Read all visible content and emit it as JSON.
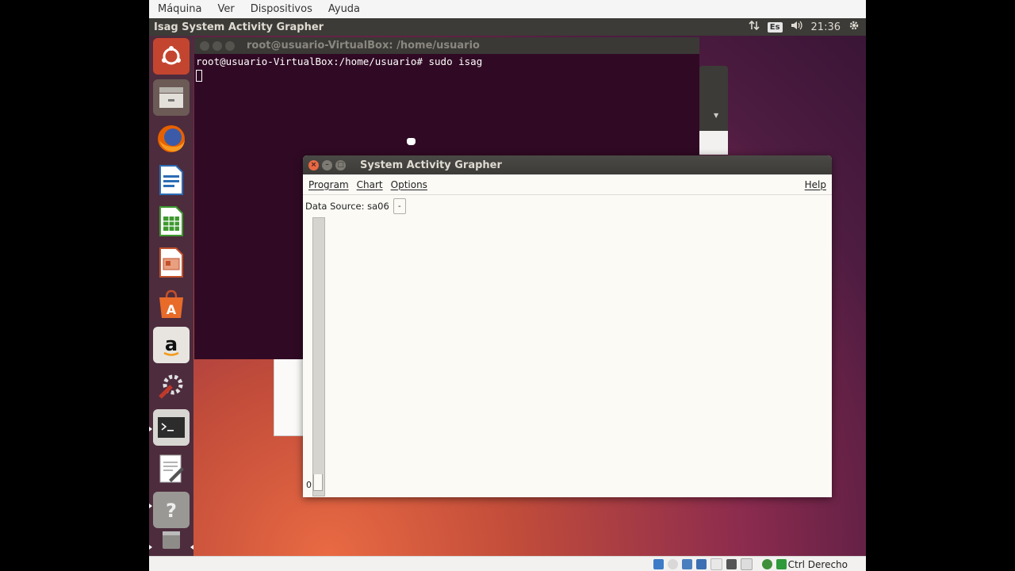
{
  "vbox_menu": [
    "Máquina",
    "Ver",
    "Dispositivos",
    "Ayuda"
  ],
  "panel": {
    "title": "Isag System Activity Grapher",
    "keyboard_layout": "Es",
    "time": "21:36"
  },
  "terminal": {
    "title": "root@usuario-VirtualBox: /home/usuario",
    "prompt_line": "root@usuario-VirtualBox:/home/usuario# sudo isag"
  },
  "isag": {
    "title": "System Activity Grapher",
    "menu": {
      "program": "Program",
      "chart": "Chart",
      "options": "Options",
      "help": "Help"
    },
    "data_source_label": "Data Source: sa06",
    "data_source_arrow": "-",
    "axis_zero": "0"
  },
  "statusbar": {
    "host_key": "Ctrl Derecho"
  },
  "launcher_icons": [
    "ubuntu-dash-icon",
    "files-icon",
    "firefox-icon",
    "writer-icon",
    "calc-icon",
    "impress-icon",
    "software-center-icon",
    "amazon-icon",
    "system-settings-icon",
    "terminal-icon",
    "text-editor-icon",
    "help-icon",
    "trash-icon"
  ]
}
